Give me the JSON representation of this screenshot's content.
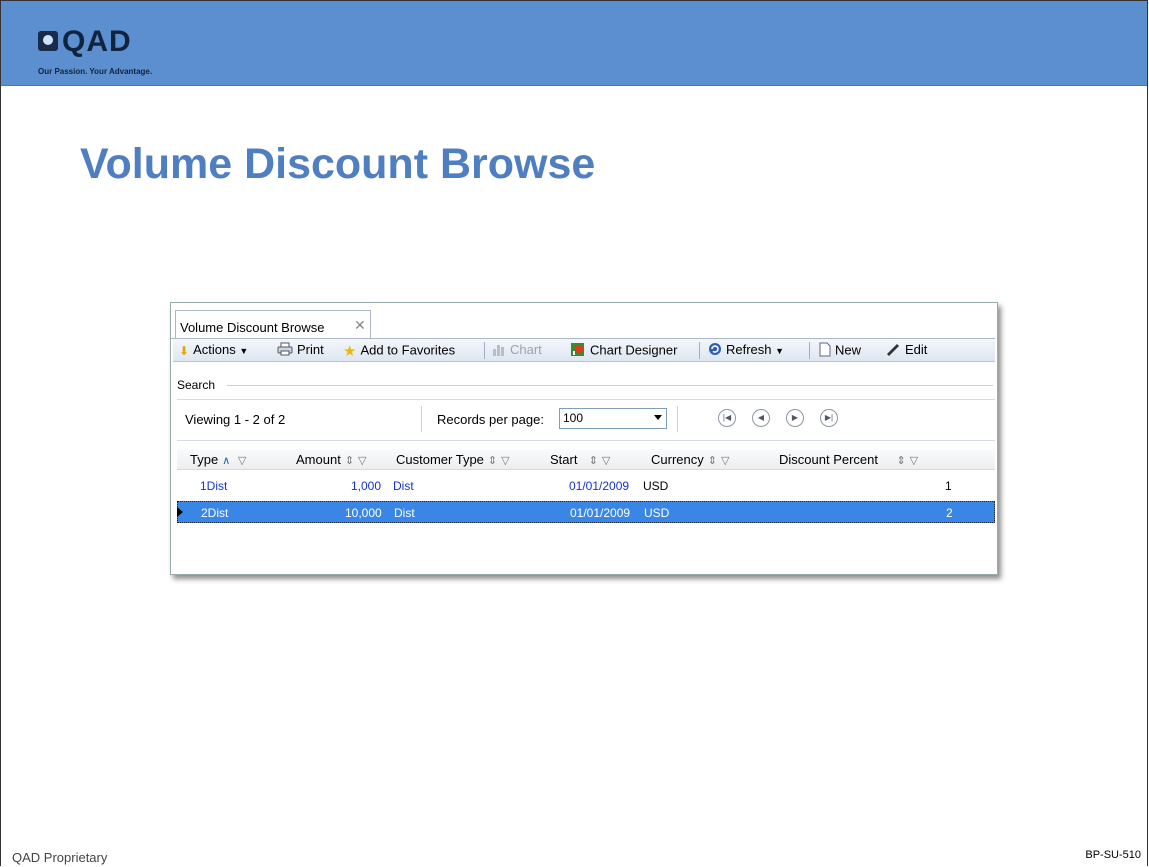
{
  "brand": {
    "name": "QAD",
    "tagline": "Our Passion. Your Advantage."
  },
  "slide": {
    "title": "Volume Discount Browse",
    "footer_left": "QAD Proprietary",
    "footer_right": "BP-SU-510"
  },
  "window": {
    "tab_label": "Volume Discount Browse",
    "toolbar": {
      "actions": "Actions",
      "print": "Print",
      "favorites": "Add to Favorites",
      "chart": "Chart",
      "chart_designer": "Chart Designer",
      "refresh": "Refresh",
      "new": "New",
      "edit": "Edit"
    },
    "search_label": "Search",
    "pager": {
      "viewing": "Viewing 1 - 2  of 2",
      "records_per_page_label": "Records per page:",
      "records_per_page_value": "100"
    },
    "columns": [
      "Type",
      "Amount",
      "Customer Type",
      "Start",
      "Currency",
      "Discount Percent"
    ],
    "rows": [
      {
        "type": "1Dist",
        "amount": "1,000",
        "customer_type": "Dist",
        "start": "01/01/2009",
        "currency": "USD",
        "discount_percent": "1"
      },
      {
        "type": "2Dist",
        "amount": "10,000",
        "customer_type": "Dist",
        "start": "01/01/2009",
        "currency": "USD",
        "discount_percent": "2"
      }
    ]
  },
  "colors": {
    "banner": "#5b8fcf",
    "title": "#4f7fc0",
    "selected_row": "#3a86e6",
    "link_text": "#1633c7"
  }
}
